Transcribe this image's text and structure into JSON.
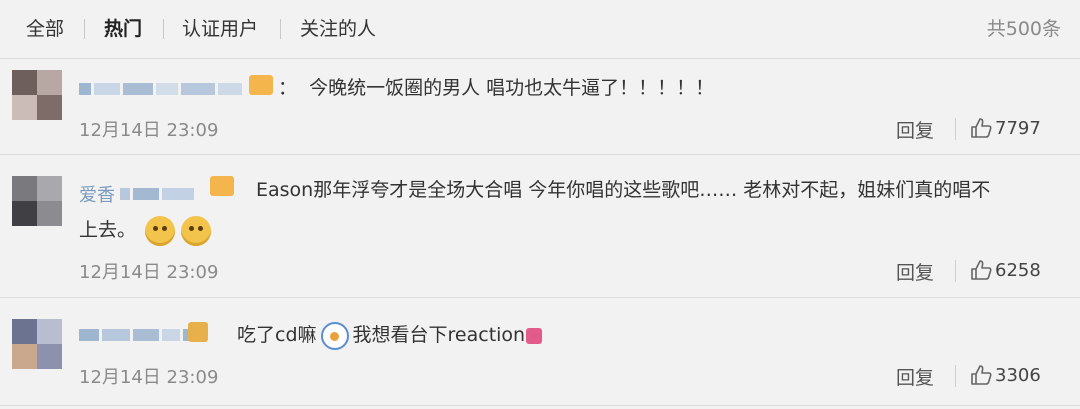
{
  "tabs": [
    {
      "label": "全部",
      "active": false
    },
    {
      "label": "热门",
      "active": true
    },
    {
      "label": "认证用户",
      "active": false
    },
    {
      "label": "关注的人",
      "active": false
    }
  ],
  "total_count": "共500条",
  "comments": [
    {
      "nickname_visible": "",
      "text": "今晚统一饭圈的男人 唱功也太牛逼了！！！！！",
      "timestamp": "12月14日 23:09",
      "reply_label": "回复",
      "likes": "7797"
    },
    {
      "nickname_visible": "爱香",
      "text_part1": "Eason那年浮夸才是全场大合唱 今年你唱的这些歌吧…… 老林对不起，姐妹们真的唱不",
      "text_part2": "上去。",
      "emojis": [
        "doge-emoji",
        "doge-emoji"
      ],
      "timestamp": "12月14日 23:09",
      "reply_label": "回复",
      "likes": "6258"
    },
    {
      "nickname_visible": "",
      "text_part1": "吃了cd嘛",
      "text_part2": "我想看台下reaction",
      "timestamp": "12月14日 23:09",
      "reply_label": "回复",
      "likes": "3306"
    }
  ],
  "icons": {
    "like": "thumbs-up-icon",
    "badge": "vip-badge-icon"
  },
  "colors": {
    "background": "#f2f2f2",
    "nickname": "#7a9bbf",
    "muted": "#8a8a8a"
  }
}
